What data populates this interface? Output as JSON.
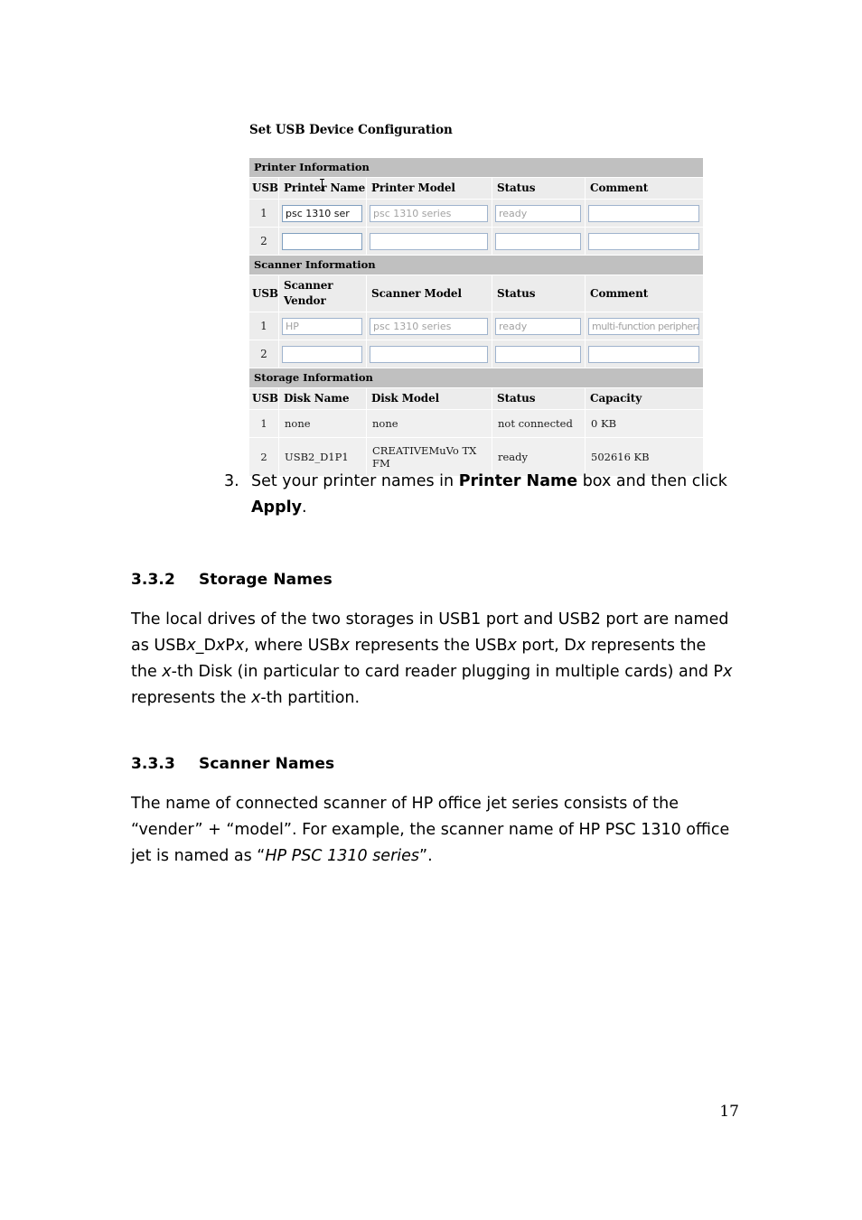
{
  "screenshot": {
    "title": "Set USB Device Configuration",
    "printer": {
      "section_label": "Printer Information",
      "headers": [
        "USB",
        "Printer Name",
        "Printer Model",
        "Status",
        "Comment"
      ],
      "rows": [
        {
          "usb": "1",
          "name": "psc 1310 ser",
          "model": "psc 1310 series",
          "status": "ready",
          "comment": ""
        },
        {
          "usb": "2",
          "name": "",
          "model": "",
          "status": "",
          "comment": ""
        }
      ]
    },
    "scanner": {
      "section_label": "Scanner Information",
      "headers": [
        "USB",
        "Scanner Vendor",
        "Scanner Model",
        "Status",
        "Comment"
      ],
      "rows": [
        {
          "usb": "1",
          "vendor": "HP",
          "model": "psc 1310 series",
          "status": "ready",
          "comment": "multi-function peripheral"
        },
        {
          "usb": "2",
          "vendor": "",
          "model": "",
          "status": "",
          "comment": ""
        }
      ]
    },
    "storage": {
      "section_label": "Storage Information",
      "headers": [
        "USB",
        "Disk Name",
        "Disk Model",
        "Status",
        "Capacity"
      ],
      "rows": [
        {
          "usb": "1",
          "name": "none",
          "model": "none",
          "status": "not connected",
          "capacity": "0 KB"
        },
        {
          "usb": "2",
          "name": "USB2_D1P1",
          "model": "CREATIVEMuVo TX FM",
          "status": "ready",
          "capacity": "502616 KB"
        }
      ]
    }
  },
  "document": {
    "step": {
      "number": "3.",
      "text_before": "Set your printer names in ",
      "bold_1": "Printer Name",
      "text_middle": " box and then click ",
      "bold_2": "Apply",
      "text_after": "."
    },
    "section_332": {
      "number": "3.3.2",
      "title": "Storage Names",
      "paragraph_p1": "The local drives of the two storages in USB1 port and USB2 port are named as USB",
      "paragraph_i1": "x",
      "paragraph_p2": "_D",
      "paragraph_i2": "x",
      "paragraph_p3": "P",
      "paragraph_i3": "x",
      "paragraph_p4": ", where USB",
      "paragraph_i4": "x",
      "paragraph_p5": " represents the USB",
      "paragraph_i5": "x",
      "paragraph_p6": " port, D",
      "paragraph_i6": "x",
      "paragraph_p7": " represents the the ",
      "paragraph_i7": "x",
      "paragraph_p8": "-th Disk (in particular to card reader plugging in multiple cards) and P",
      "paragraph_i8": "x",
      "paragraph_p9": " represents the ",
      "paragraph_i9": "x",
      "paragraph_p10": "-th partition."
    },
    "section_333": {
      "number": "3.3.3",
      "title": "Scanner Names",
      "paragraph_p1": "The name of connected scanner of HP office jet series consists of the “vender” + “model”. For example, the scanner name of HP PSC 1310 office jet is named as “",
      "paragraph_i1": "HP PSC 1310 series",
      "paragraph_p2": "”."
    },
    "page_number": "17"
  },
  "colors": {
    "section_header_bg": "#c0c0c0",
    "column_header_bg": "#ececec",
    "cell_bg": "#ececec",
    "input_border": "#8099bf",
    "readonly_text": "#a2a2a2",
    "page_bg": "#ffffff"
  }
}
